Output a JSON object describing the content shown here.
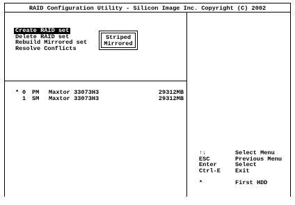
{
  "title": "RAID Configuration Utility - Silicon Image Inc. Copyright (C) 2002",
  "menu": {
    "items": [
      {
        "label": "Create RAID set",
        "selected": true
      },
      {
        "label": "Delete RAID set",
        "selected": false
      },
      {
        "label": "Rebuild Mirrored set",
        "selected": false
      },
      {
        "label": "Resolve Conflicts",
        "selected": false
      }
    ]
  },
  "popup": {
    "options": [
      "Striped",
      "Mirrored"
    ]
  },
  "disks": [
    {
      "mark": "*",
      "number": "0",
      "role": "PM",
      "model": "Maxtor 33073H3",
      "size": "29312MB"
    },
    {
      "mark": "",
      "number": "1",
      "role": "SM",
      "model": "Maxtor 33073H3",
      "size": "29312MB"
    }
  ],
  "help": {
    "rows": [
      {
        "key": "↑↓",
        "desc": "Select Menu"
      },
      {
        "key": "ESC",
        "desc": "Previous Menu"
      },
      {
        "key": "Enter",
        "desc": "Select"
      },
      {
        "key": "Ctrl-E",
        "desc": "Exit"
      }
    ],
    "legend": {
      "key": "*",
      "desc": "First HDD"
    }
  }
}
